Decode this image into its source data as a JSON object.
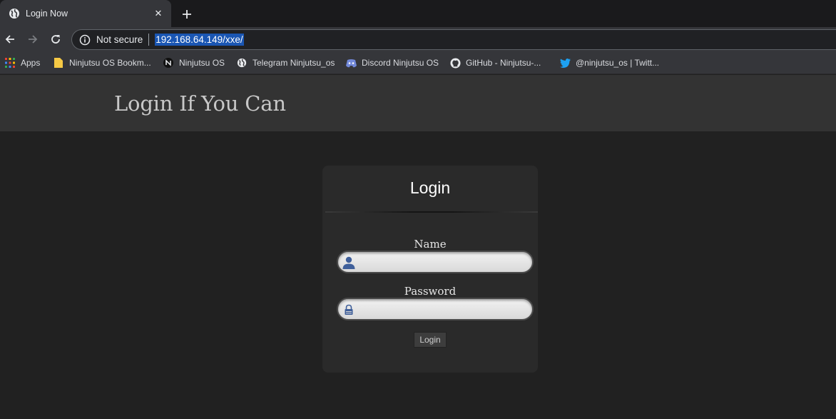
{
  "browser": {
    "tab": {
      "title": "Login Now"
    },
    "security_label": "Not secure",
    "url": "192.168.64.149/xxe/",
    "bookmarks": [
      {
        "label": "Apps",
        "icon": "apps-grid-icon"
      },
      {
        "label": "Ninjutsu OS Bookm...",
        "icon": "folder-icon"
      },
      {
        "label": "Ninjutsu OS",
        "icon": "ninjutsu-logo-icon"
      },
      {
        "label": "Telegram Ninjutsu_os",
        "icon": "globe-icon"
      },
      {
        "label": "Discord Ninjutsu OS",
        "icon": "discord-icon"
      },
      {
        "label": "GitHub - Ninjutsu-...",
        "icon": "github-icon"
      },
      {
        "label": "@ninjutsu_os | Twitt...",
        "icon": "twitter-bird-icon"
      }
    ]
  },
  "site": {
    "title": "Login If You Can"
  },
  "login": {
    "heading": "Login",
    "name_label": "Name",
    "name_value": "",
    "password_label": "Password",
    "password_value": "",
    "button_label": "Login"
  },
  "colors": {
    "page_bg": "#212121",
    "header_bg": "#333333",
    "card_bg": "#2a2a2a",
    "url_highlight": "#1a56b3"
  }
}
